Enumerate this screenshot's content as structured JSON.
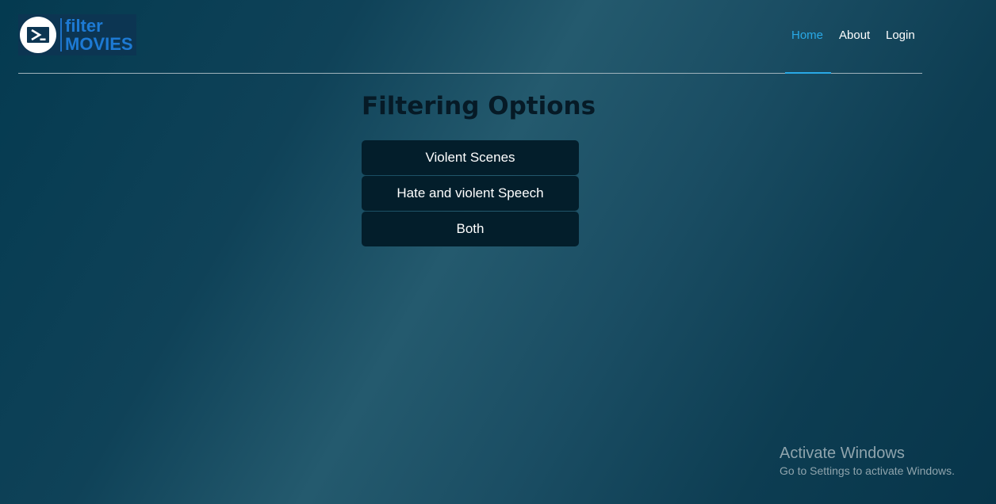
{
  "logo": {
    "line1": "filter",
    "line2": "MOVIES",
    "icon": "play-arrow-icon",
    "brand_color": "#1d7ad4"
  },
  "nav": {
    "home": "Home",
    "about": "About",
    "login": "Login",
    "active_item": "home",
    "active_color": "#29a9e6"
  },
  "main": {
    "title": "Filtering Options",
    "options": [
      {
        "label": "Violent Scenes"
      },
      {
        "label": "Hate and violent Speech"
      },
      {
        "label": "Both"
      }
    ]
  },
  "watermark": {
    "title": "Activate Windows",
    "subtitle": "Go to Settings to activate Windows."
  }
}
